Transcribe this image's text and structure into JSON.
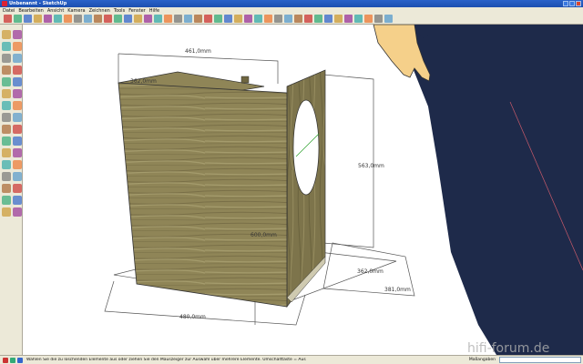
{
  "window": {
    "title": "Unbenannt - SketchUp"
  },
  "menu": [
    "Datei",
    "Bearbeiten",
    "Ansicht",
    "Kamera",
    "Zeichnen",
    "Tools",
    "Fenster",
    "Hilfe"
  ],
  "viewport": {
    "dimensions": {
      "top_width": "461,0mm",
      "top_depth": "362,0mm",
      "height_right": "563,0mm",
      "inner_height": "600,0mm",
      "bottom_depth_inner": "362,0mm",
      "bottom_depth_outer": "381,0mm",
      "bottom_width": "480,0mm"
    },
    "watermark": "hifi-forum.de"
  },
  "status": {
    "hint": "Wählen Sie die zu löschenden Elemente aus oder ziehen Sie den Mauszeiger zur Auswahl über mehrere Elemente. Umschalttaste = Aus",
    "vcb_label": "Maßangaben",
    "vcb_value": ""
  },
  "colors": {
    "titlebar": "#1c4fb0",
    "chrome": "#ece9d8",
    "wood": "#8f8557",
    "dimension_line": "#555555",
    "jeans": "#1e2a4a",
    "skin": "#f5d08a"
  },
  "icons": {
    "toolbar": [
      "select",
      "eraser",
      "line",
      "arc",
      "freehand",
      "rectangle",
      "circle",
      "polygon",
      "push-pull",
      "follow-me",
      "move",
      "rotate",
      "scale",
      "offset",
      "tape-measure",
      "dimension",
      "protractor",
      "text",
      "axes",
      "3d-text",
      "orbit",
      "pan",
      "zoom",
      "zoom-window",
      "zoom-extents",
      "previous-view",
      "next-view",
      "iso-view",
      "top-view",
      "front-view",
      "right-view",
      "back-view",
      "left-view",
      "xray",
      "wireframe",
      "hidden-line",
      "shaded",
      "textured",
      "monochrome"
    ],
    "left": [
      "select",
      "eraser",
      "line",
      "freehand",
      "rectangle",
      "circle",
      "arc",
      "polygon",
      "push-pull",
      "follow-me",
      "move",
      "rotate",
      "scale",
      "offset",
      "tape-measure",
      "dimension",
      "protractor",
      "text",
      "axes",
      "3d-text",
      "paint-bucket",
      "section-plane",
      "orbit",
      "pan",
      "zoom",
      "zoom-window",
      "zoom-extents",
      "previous",
      "walk",
      "look-around",
      "position-camera",
      "sandbox"
    ]
  }
}
